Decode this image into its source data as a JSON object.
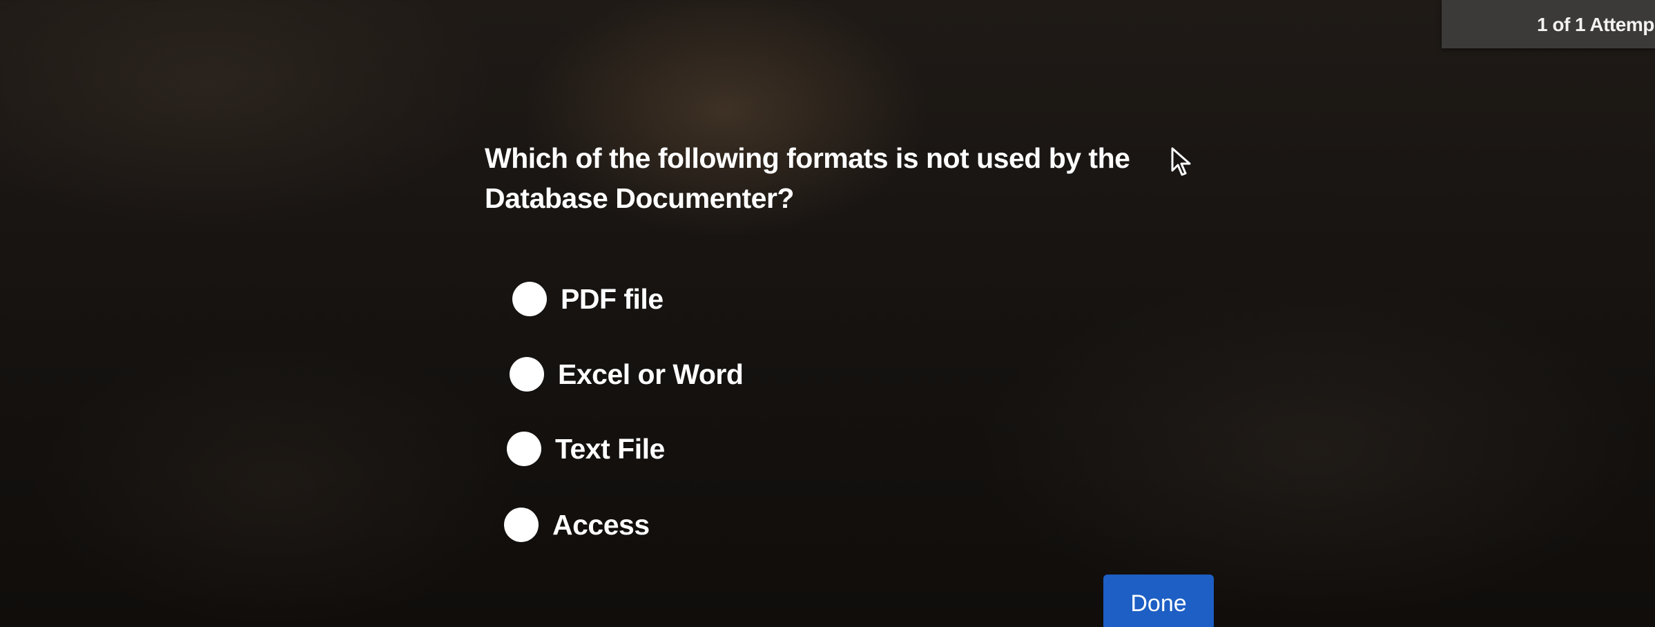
{
  "header": {
    "attempts_label": "1 of 1 Attemp"
  },
  "quiz": {
    "question": "Which of the following formats is not used by the Database Documenter?",
    "options": [
      {
        "label": "PDF file"
      },
      {
        "label": "Excel or Word"
      },
      {
        "label": "Text File"
      },
      {
        "label": "Access"
      }
    ],
    "done_label": "Done"
  },
  "icons": {
    "cursor": "mouse-pointer-icon",
    "radio": "radio-button-icon"
  },
  "colors": {
    "background": "#151210",
    "text": "#ffffff",
    "attempts_panel": "#3b3a38",
    "done_button": "#1d5fc4",
    "radio_fill": "#ffffff"
  }
}
